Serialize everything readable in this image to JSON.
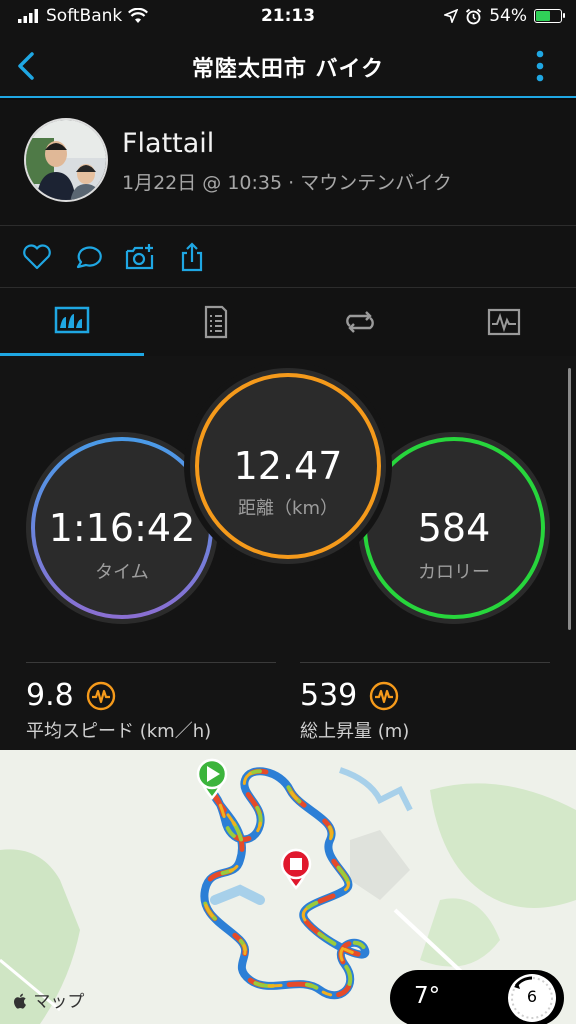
{
  "status_bar": {
    "carrier": "SoftBank",
    "time": "21:13",
    "battery": "54%",
    "battery_level": 0.54
  },
  "nav": {
    "title": "常陸太田市 バイク"
  },
  "profile": {
    "name": "Flattail",
    "meta": "1月22日 @ 10:35 · マウンテンバイク"
  },
  "tabs": [
    {
      "icon": "summary-chart-icon",
      "active": true
    },
    {
      "icon": "details-list-icon",
      "active": false
    },
    {
      "icon": "laps-loop-icon",
      "active": false
    },
    {
      "icon": "graph-icon",
      "active": false
    }
  ],
  "rings": {
    "time": {
      "value": "1:16:42",
      "label": "タイム"
    },
    "distance": {
      "value": "12.47",
      "label": "距離（km）"
    },
    "calories": {
      "value": "584",
      "label": "カロリー"
    }
  },
  "metrics": {
    "speed": {
      "value": "9.8",
      "label": "平均スピード (km／h)"
    },
    "ascent": {
      "value": "539",
      "label": "総上昇量 (m)"
    }
  },
  "map": {
    "credit": "マップ",
    "temperature": "7°",
    "wind": "6"
  },
  "colors": {
    "accent": "#1fa7e3",
    "time_ring": "#5b7fd8",
    "distance_ring": "#f59a1b",
    "calorie_ring": "#27d63c",
    "start_marker": "#3cb43c",
    "end_marker": "#e0182d"
  }
}
